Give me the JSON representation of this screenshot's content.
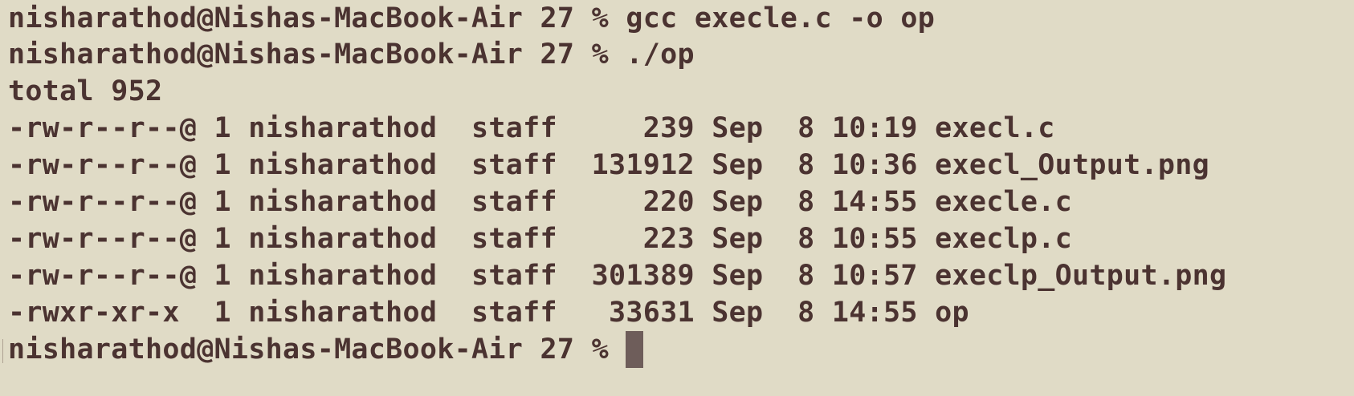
{
  "terminal": {
    "lines": [
      "nisharathod@Nishas-MacBook-Air 27 % gcc execle.c -o op",
      "nisharathod@Nishas-MacBook-Air 27 % ./op",
      "total 952",
      "-rw-r--r--@ 1 nisharathod  staff     239 Sep  8 10:19 execl.c",
      "-rw-r--r--@ 1 nisharathod  staff  131912 Sep  8 10:36 execl_Output.png",
      "-rw-r--r--@ 1 nisharathod  staff     220 Sep  8 14:55 execle.c",
      "-rw-r--r--@ 1 nisharathod  staff     223 Sep  8 10:55 execlp.c",
      "-rw-r--r--@ 1 nisharathod  staff  301389 Sep  8 10:57 execlp_Output.png",
      "-rwxr-xr-x  1 nisharathod  staff   33631 Sep  8 14:55 op"
    ],
    "prompt": "nisharathod@Nishas-MacBook-Air 27 % "
  },
  "colors": {
    "background": "#e0dbc6",
    "text": "#4b3331",
    "cursor": "#6e5d5a"
  }
}
